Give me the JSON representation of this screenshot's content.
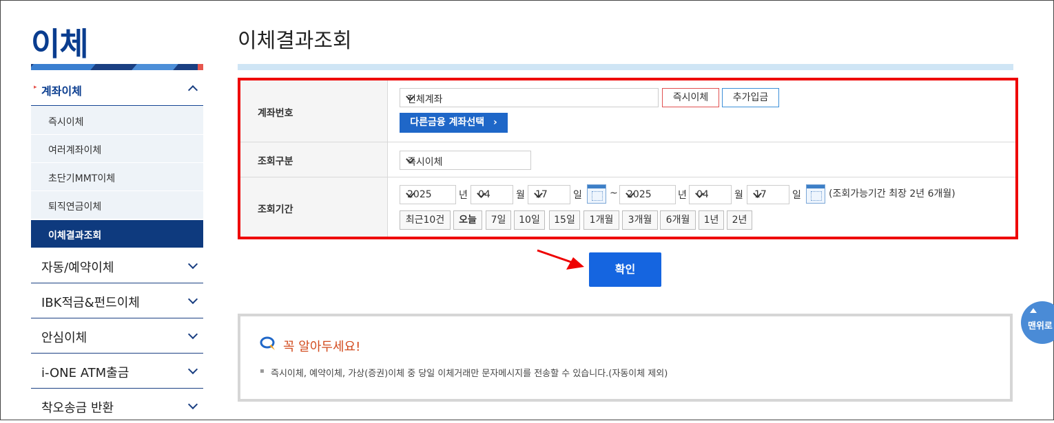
{
  "sidebar": {
    "title": "이체",
    "section": {
      "label": "계좌이체"
    },
    "sub_items": [
      {
        "label": "즉시이체"
      },
      {
        "label": "여러계좌이체"
      },
      {
        "label": "초단기MMT이체"
      },
      {
        "label": "퇴직연금이체"
      },
      {
        "label": "이체결과조회",
        "active": true
      }
    ],
    "menu_items": [
      {
        "label": "자동/예약이체"
      },
      {
        "label": "IBK적금&펀드이체"
      },
      {
        "label": "안심이체"
      },
      {
        "label": "i-ONE ATM출금"
      },
      {
        "label": "착오송금 반환"
      }
    ]
  },
  "main": {
    "title": "이체결과조회",
    "form": {
      "account": {
        "label": "계좌번호",
        "select_value": "전체계좌",
        "instant_transfer_button": "즉시이체",
        "add_deposit_button": "추가입금",
        "other_finance_button": "다른금융 계좌선택"
      },
      "query_type": {
        "label": "조회구분",
        "select_value": "즉시이체"
      },
      "period": {
        "label": "조회기간",
        "from": {
          "year": "2025",
          "year_unit": "년",
          "month": "04",
          "month_unit": "월",
          "day": "17",
          "day_unit": "일"
        },
        "separator": "~",
        "to": {
          "year": "2025",
          "year_unit": "년",
          "month": "04",
          "month_unit": "월",
          "day": "17",
          "day_unit": "일"
        },
        "note": "(조회가능기간 최장 2년 6개월)",
        "quick_buttons": [
          "최근10건",
          "오늘",
          "7일",
          "10일",
          "15일",
          "1개월",
          "3개월",
          "6개월",
          "1년",
          "2년"
        ]
      }
    },
    "confirm_button": "확인",
    "notice": {
      "title": "꼭 알아두세요!",
      "bullet": "▪",
      "message": "즉시이체, 예약이체, 가상(증권)이체 중 당일 이체거래만 문자메시지를 전송할 수 있습니다.(자동이체 제외)"
    },
    "top_button": "맨위로"
  },
  "colors": {
    "brand_navy": "#0a3d8f",
    "highlight_red": "#ee0000",
    "confirm_blue": "#1565e0",
    "notice_orange": "#d24b1e"
  }
}
